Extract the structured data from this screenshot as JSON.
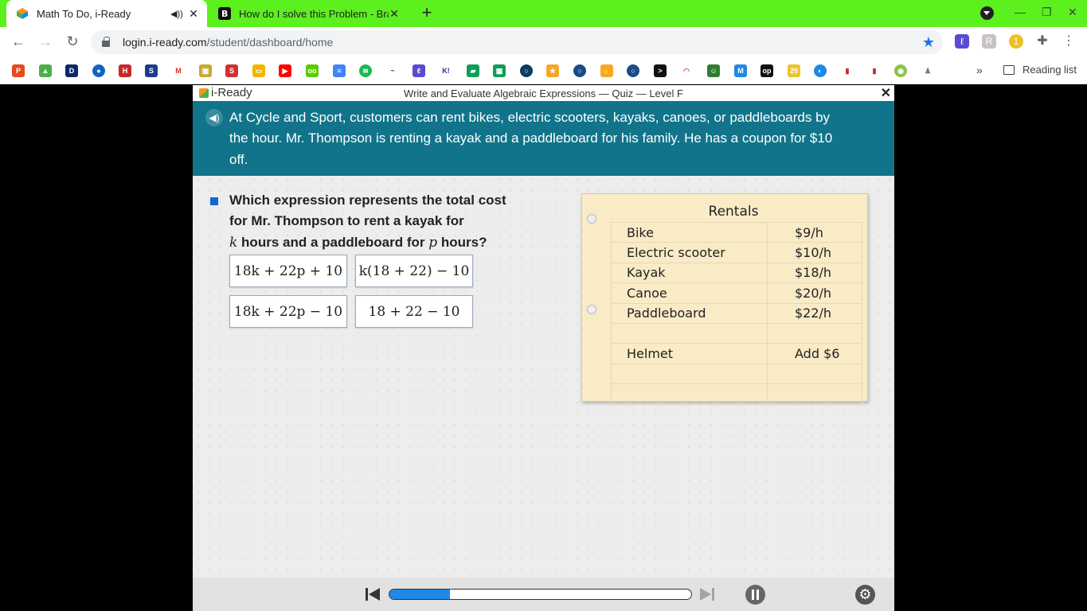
{
  "browser": {
    "tabs": [
      {
        "title": "Math To Do, i-Ready",
        "active": true
      },
      {
        "title": "How do I solve this Problem - Bra",
        "active": false
      }
    ],
    "url_host": "login.i-ready.com",
    "url_path": "/student/dashboard/home",
    "bookmarks_overflow": "»",
    "reading_list": "Reading list",
    "colors": {
      "tab_strip": "#5cf01e",
      "star": "#1a73e8"
    }
  },
  "app": {
    "logo": "i-Ready",
    "quiz_title": "Write and Evaluate Algebraic Expressions — Quiz — Level F",
    "close": "✕",
    "prompt": "At Cycle and Sport, customers can rent bikes, electric scooters, kayaks, canoes, or paddleboards by the hour. Mr. Thompson is renting a kayak and a paddleboard for his family. He has a coupon for $10 off.",
    "question": {
      "part1": "Which expression represents the total cost for Mr. Thompson to rent a kayak for",
      "var_k": "k",
      "part2": "hours and a paddleboard for",
      "var_p": "p",
      "part3": "hours?"
    },
    "choices": [
      "18k + 22p + 10",
      "k(18 + 22) − 10",
      "18k + 22p − 10",
      "18 + 22 − 10"
    ],
    "rentals": {
      "title": "Rentals",
      "rows": [
        {
          "item": "Bike",
          "price": "$9/h"
        },
        {
          "item": "Electric scooter",
          "price": "$10/h"
        },
        {
          "item": "Kayak",
          "price": "$18/h"
        },
        {
          "item": "Canoe",
          "price": "$20/h"
        },
        {
          "item": "Paddleboard",
          "price": "$22/h"
        },
        {
          "item": "",
          "price": ""
        },
        {
          "item": "Helmet",
          "price": "Add $6"
        },
        {
          "item": "",
          "price": ""
        },
        {
          "item": "",
          "price": ""
        }
      ]
    },
    "progress_fraction": 0.2,
    "colors": {
      "prompt_bg": "#11748a",
      "progress": "#1e88e5",
      "question_marker": "#1565d8"
    }
  }
}
